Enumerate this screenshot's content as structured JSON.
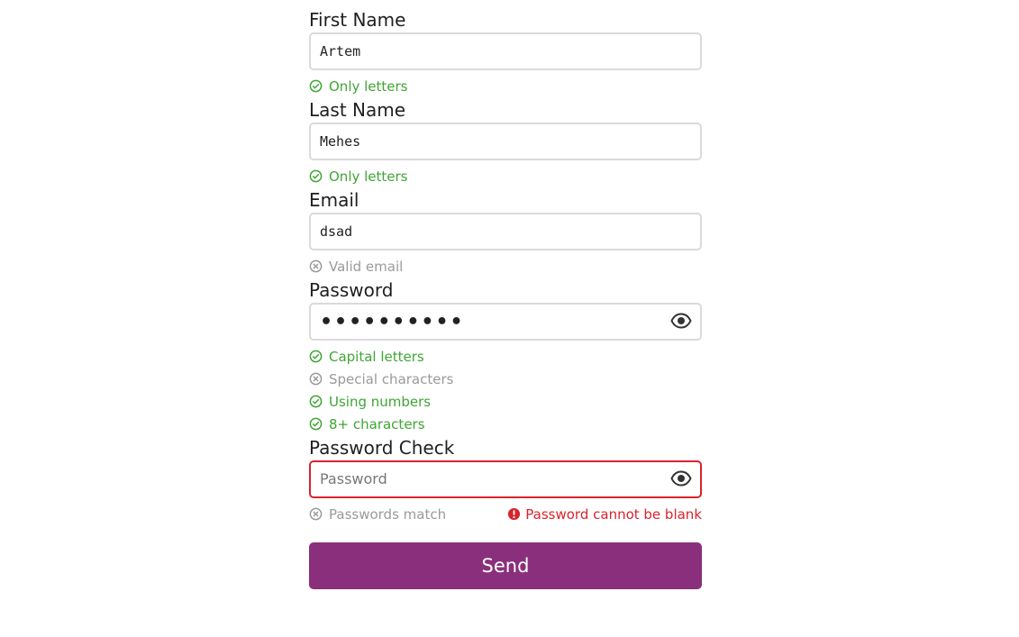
{
  "form": {
    "first_name": {
      "label": "First Name",
      "value": "Artem",
      "rules": [
        {
          "text": "Only letters",
          "status": "ok"
        }
      ]
    },
    "last_name": {
      "label": "Last Name",
      "value": "Mehes",
      "rules": [
        {
          "text": "Only letters",
          "status": "ok"
        }
      ]
    },
    "email": {
      "label": "Email",
      "value": "dsad",
      "rules": [
        {
          "text": "Valid email",
          "status": "bad"
        }
      ]
    },
    "password": {
      "label": "Password",
      "value": "••••••••••",
      "rules": [
        {
          "text": "Capital letters",
          "status": "ok"
        },
        {
          "text": "Special characters",
          "status": "bad"
        },
        {
          "text": "Using numbers",
          "status": "ok"
        },
        {
          "text": "8+ characters",
          "status": "ok"
        }
      ]
    },
    "password_check": {
      "label": "Password Check",
      "value": "",
      "placeholder": "Password",
      "rule": {
        "text": "Passwords match",
        "status": "bad"
      },
      "error": "Password cannot be blank"
    },
    "send_label": "Send"
  },
  "colors": {
    "ok": "#3fa535",
    "bad": "#9a9a9a",
    "error": "#d9232d",
    "button": "#8a2f7c"
  },
  "icons": {
    "ok": "check-circle-icon",
    "bad": "x-circle-icon",
    "error": "exclamation-circle-icon",
    "toggle": "eye-icon"
  }
}
